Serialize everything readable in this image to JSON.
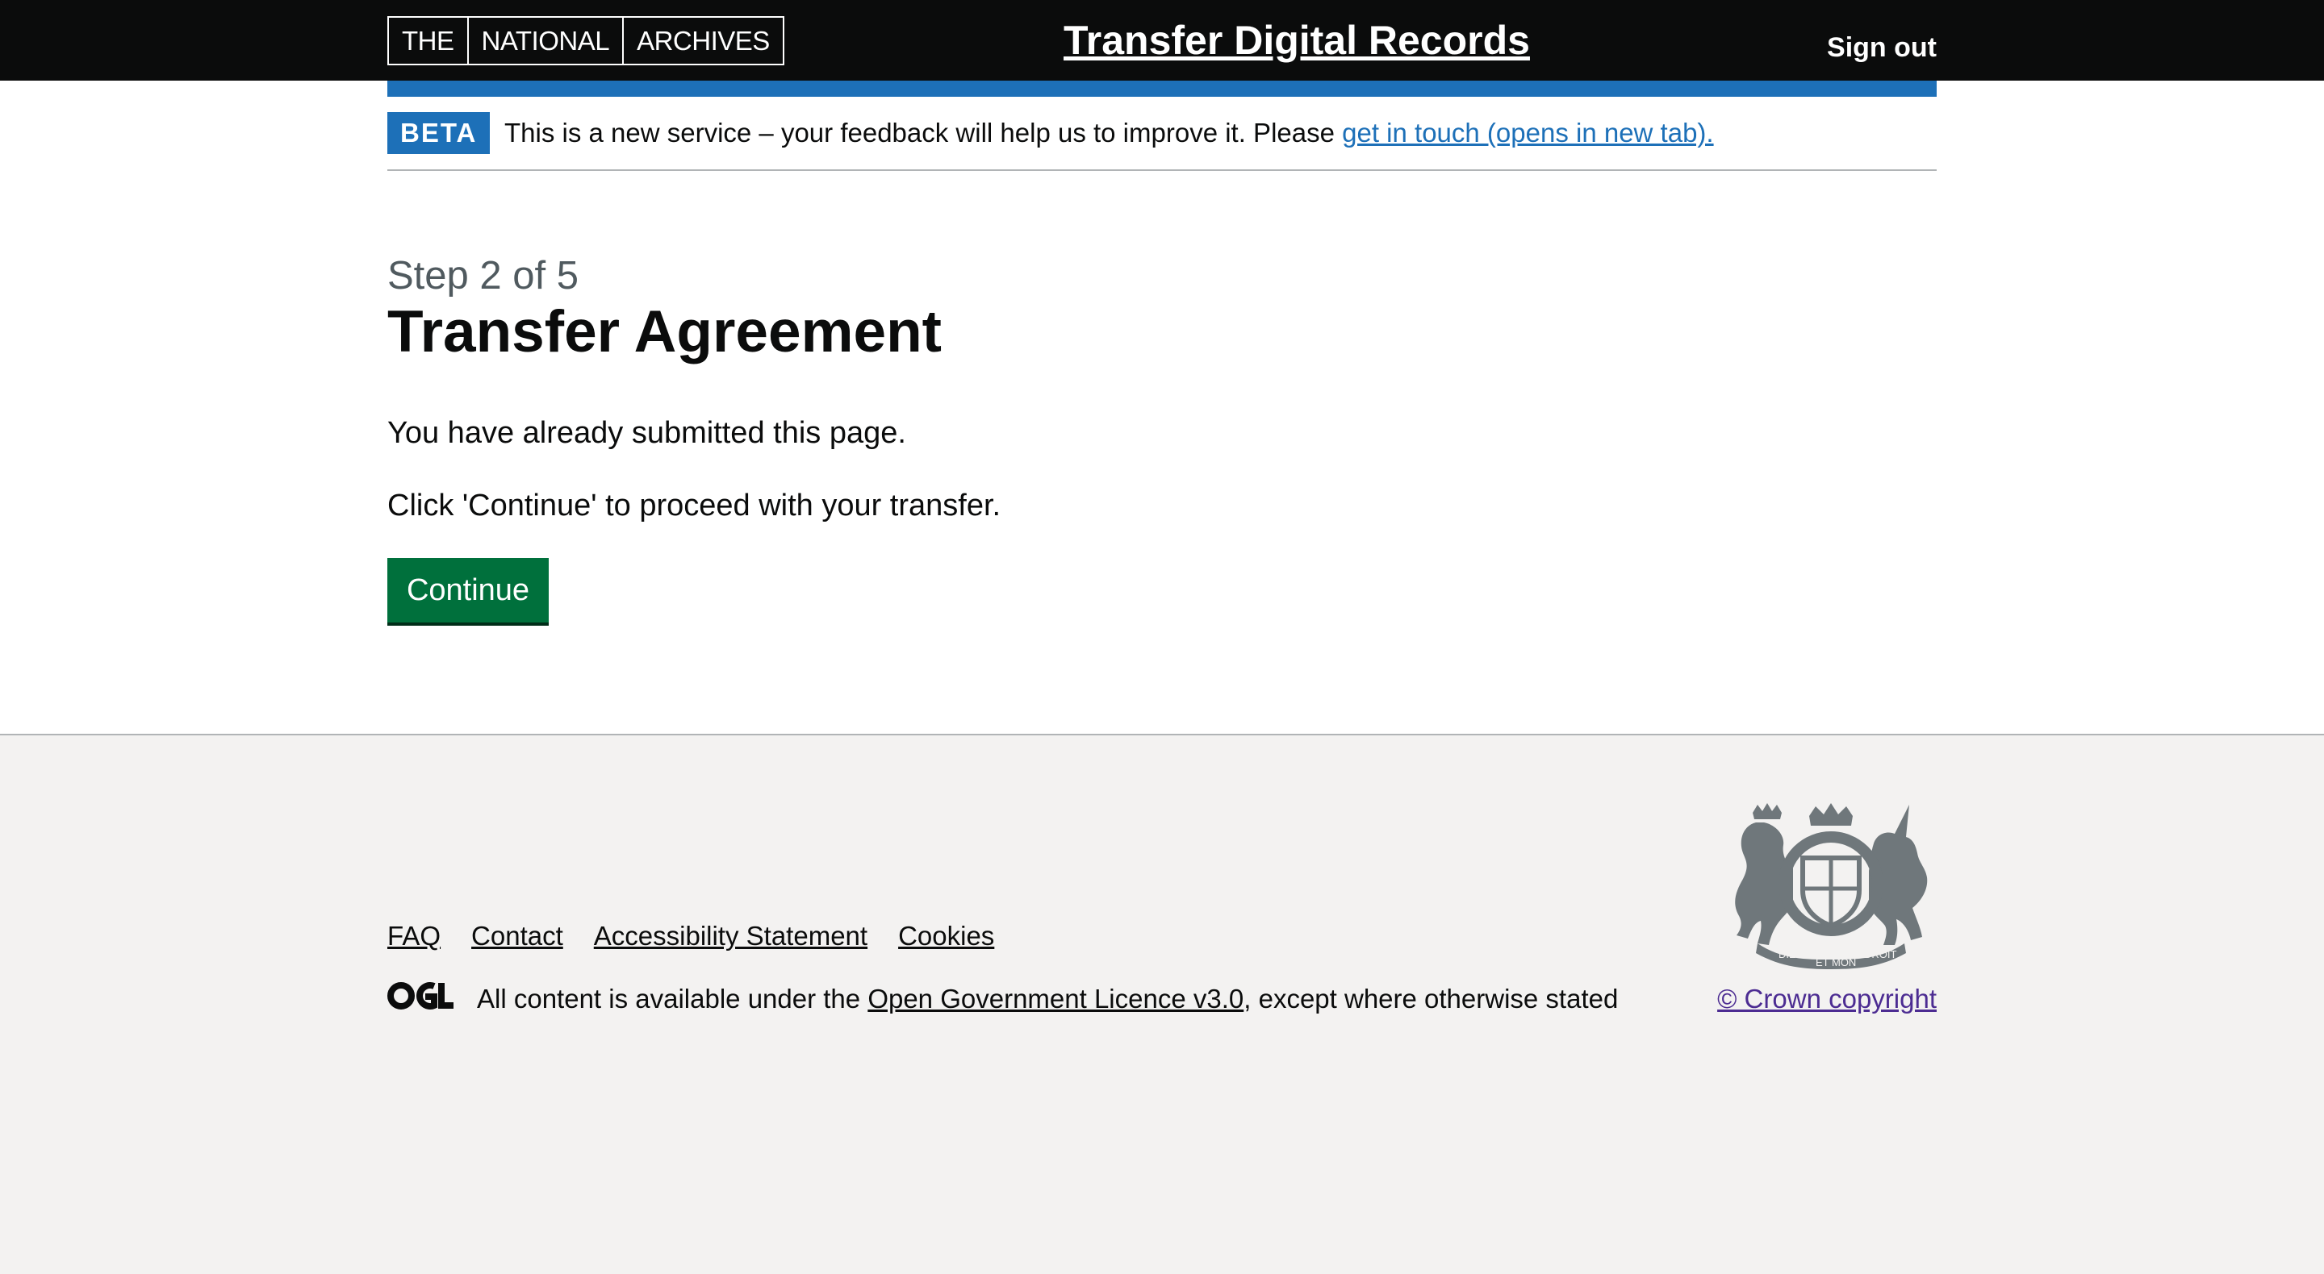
{
  "header": {
    "logo_parts": [
      "THE",
      "NATIONAL",
      "ARCHIVES"
    ],
    "service_name": "Transfer Digital Records",
    "sign_out": "Sign out"
  },
  "phase_banner": {
    "tag": "BETA",
    "text": "This is a new service – your feedback will help us to improve it. Please ",
    "link": "get in touch (opens in new tab)."
  },
  "main": {
    "caption": "Step 2 of 5",
    "title": "Transfer Agreement",
    "paragraphs": [
      "You have already submitted this page.",
      "Click 'Continue' to proceed with your transfer."
    ],
    "continue_button": "Continue"
  },
  "footer": {
    "links": [
      "FAQ",
      "Contact",
      "Accessibility Statement",
      "Cookies"
    ],
    "ogl_logo_text": "OGL",
    "licence_prefix": "All content is available under the ",
    "licence_link": "Open Government Licence v3.0",
    "licence_suffix": ", except where otherwise stated",
    "crest_mottos": [
      "DIEU ET MON DROIT",
      "HONI SOIT QUI MAL Y PENSE"
    ],
    "copyright": "© Crown copyright"
  },
  "colors": {
    "header_bg": "#0b0c0c",
    "brand_blue": "#1d70b8",
    "button_green": "#00703c",
    "footer_bg": "#f3f2f1",
    "crest_grey": "#6f777b",
    "copyright_link": "#4c2c92"
  }
}
